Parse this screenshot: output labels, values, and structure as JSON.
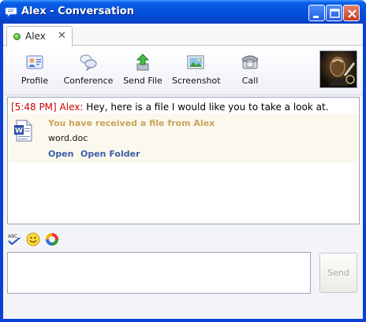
{
  "window": {
    "title": "Alex - Conversation"
  },
  "tabs": [
    {
      "label": "Alex",
      "status": "online",
      "close_glyph": "✕"
    }
  ],
  "toolbar": {
    "items": [
      {
        "label": "Profile",
        "icon": "profile-icon"
      },
      {
        "label": "Conference",
        "icon": "conference-icon"
      },
      {
        "label": "Send File",
        "icon": "send-file-icon"
      },
      {
        "label": "Screenshot",
        "icon": "screenshot-icon"
      },
      {
        "label": "Call",
        "icon": "call-icon"
      }
    ]
  },
  "conversation": {
    "message": {
      "time": "[5:48 PM]",
      "sender": "Alex:",
      "text": "Hey, here is a file I would like you to take a look at."
    },
    "file_transfer": {
      "heading": "You have received a file from Alex",
      "file_name": "word.doc",
      "open_label": "Open",
      "open_folder_label": "Open Folder"
    }
  },
  "input": {
    "value": "",
    "send_label": "Send"
  },
  "colors": {
    "titlebar": "#0552df",
    "time_text": "#cc0000",
    "file_heading": "#c9a45c",
    "link": "#3c5ea8"
  }
}
